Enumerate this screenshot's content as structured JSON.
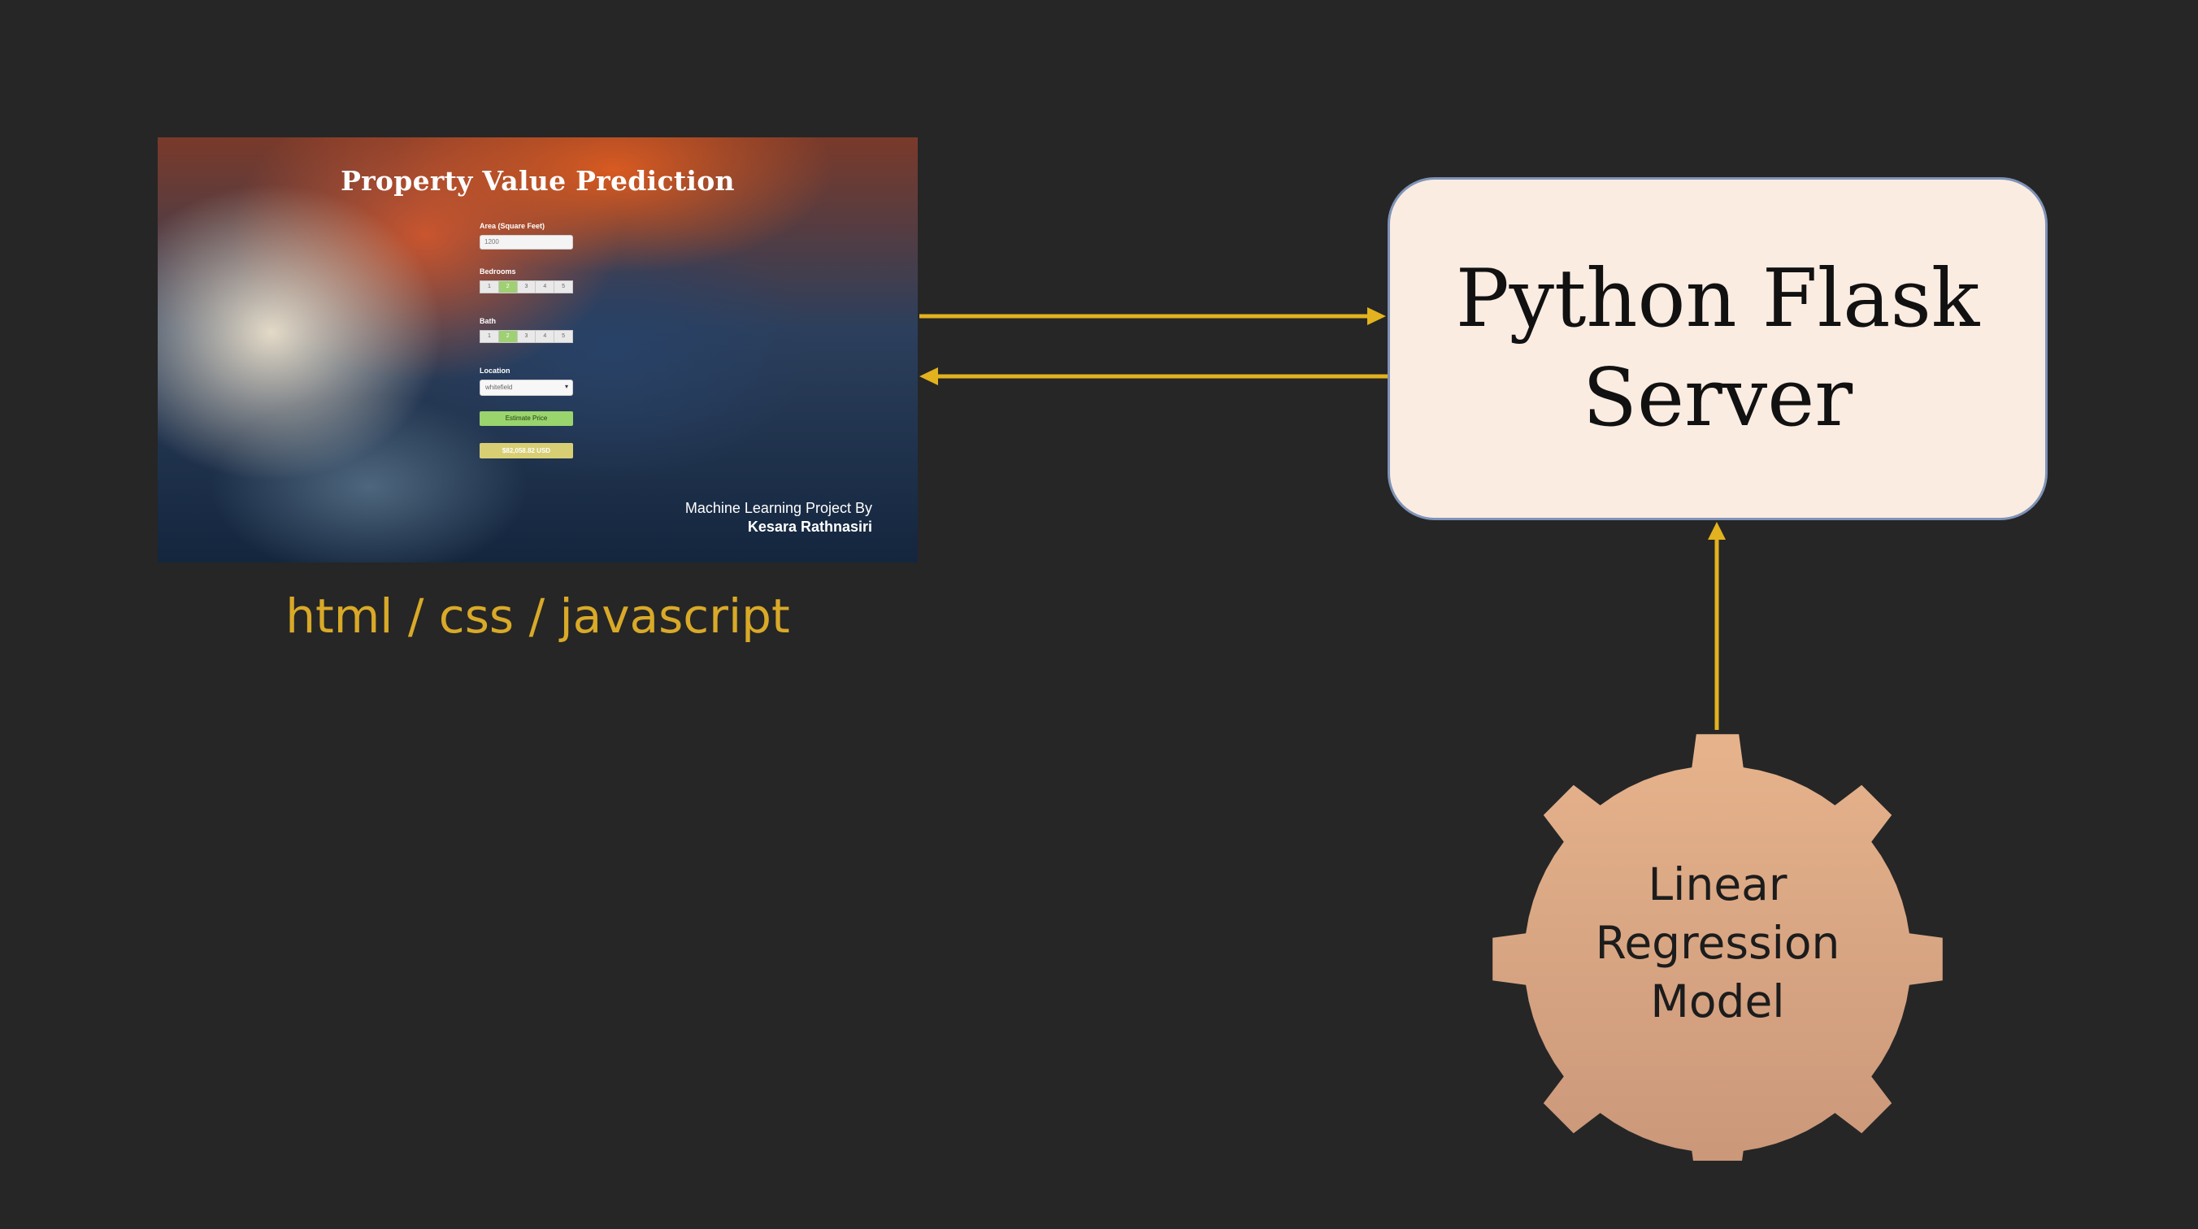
{
  "app": {
    "title": "Property Value Prediction",
    "area_label": "Area (Square Feet)",
    "area_value": "1200",
    "bedrooms_label": "Bedrooms",
    "bedroom_options": [
      "1",
      "2",
      "3",
      "4",
      "5"
    ],
    "bedrooms_selected": "2",
    "bath_label": "Bath",
    "bath_options": [
      "1",
      "2",
      "3",
      "4",
      "5"
    ],
    "bath_selected": "2",
    "location_label": "Location",
    "location_value": "whitefield",
    "estimate_button": "Estimate Price",
    "result": "$82,058.82 USD",
    "credit_line": "Machine Learning Project By",
    "credit_author": "Kesara Rathnasiri"
  },
  "labels": {
    "frontend_tech": "html / css / javascript",
    "server_line1": "Python Flask",
    "server_line2": "Server",
    "model_line1": "Linear",
    "model_line2": "Regression",
    "model_line3": "Model"
  },
  "colors": {
    "background": "#262626",
    "arrow": "#e2b21f",
    "tech_label": "#d9a928",
    "server_fill": "#fbece2",
    "server_border": "#7e93b8",
    "gear_fill": "#dcaa82",
    "estimate_button": "#9ad46d",
    "result_box": "#d8cf74"
  },
  "icons": {
    "gear": "gear-icon",
    "select_caret": "chevron-down-icon"
  }
}
